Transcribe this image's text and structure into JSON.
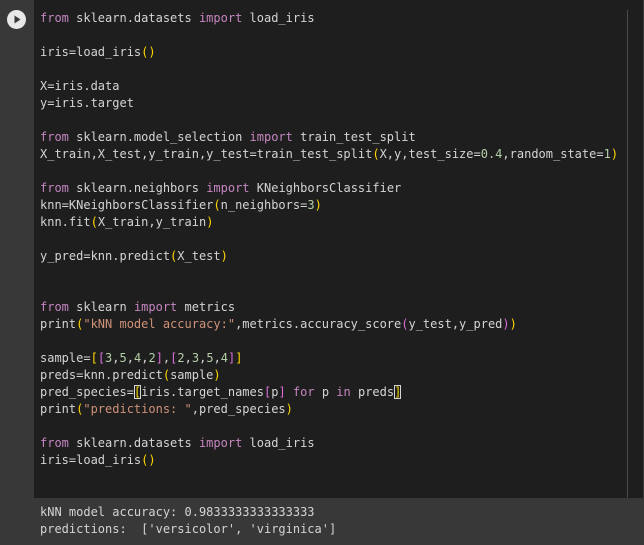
{
  "code_lines": [
    [
      [
        "kw",
        "from"
      ],
      [
        "t",
        " sklearn.datasets "
      ],
      [
        "kw",
        "import"
      ],
      [
        "t",
        " load_iris"
      ]
    ],
    [],
    [
      [
        "t",
        "iris=load_iris"
      ],
      [
        "p1",
        "()"
      ]
    ],
    [],
    [
      [
        "t",
        "X=iris.data"
      ]
    ],
    [
      [
        "t",
        "y=iris.target"
      ]
    ],
    [],
    [
      [
        "kw",
        "from"
      ],
      [
        "t",
        " sklearn.model_selection "
      ],
      [
        "kw",
        "import"
      ],
      [
        "t",
        " train_test_split"
      ]
    ],
    [
      [
        "t",
        "X_train,X_test,y_train,y_test=train_test_split"
      ],
      [
        "p1",
        "("
      ],
      [
        "t",
        "X,y,test_size="
      ],
      [
        "num",
        "0.4"
      ],
      [
        "t",
        ",random_state="
      ],
      [
        "num",
        "1"
      ],
      [
        "p1",
        ")"
      ]
    ],
    [],
    [
      [
        "kw",
        "from"
      ],
      [
        "t",
        " sklearn.neighbors "
      ],
      [
        "kw",
        "import"
      ],
      [
        "t",
        " KNeighborsClassifier"
      ]
    ],
    [
      [
        "t",
        "knn=KNeighborsClassifier"
      ],
      [
        "p1",
        "("
      ],
      [
        "t",
        "n_neighbors="
      ],
      [
        "num",
        "3"
      ],
      [
        "p1",
        ")"
      ]
    ],
    [
      [
        "t",
        "knn.fit"
      ],
      [
        "p1",
        "("
      ],
      [
        "t",
        "X_train,y_train"
      ],
      [
        "p1",
        ")"
      ]
    ],
    [],
    [
      [
        "t",
        "y_pred=knn.predict"
      ],
      [
        "p1",
        "("
      ],
      [
        "t",
        "X_test"
      ],
      [
        "p1",
        ")"
      ]
    ],
    [],
    [],
    [
      [
        "kw",
        "from"
      ],
      [
        "t",
        " sklearn "
      ],
      [
        "kw",
        "import"
      ],
      [
        "t",
        " metrics"
      ]
    ],
    [
      [
        "t",
        "print"
      ],
      [
        "p1",
        "("
      ],
      [
        "str",
        "\"kNN model accuracy:\""
      ],
      [
        "t",
        ",metrics.accuracy_score"
      ],
      [
        "p2",
        "("
      ],
      [
        "t",
        "y_test,y_pred"
      ],
      [
        "p2",
        ")"
      ],
      [
        "p1",
        ")"
      ]
    ],
    [],
    [
      [
        "t",
        "sample="
      ],
      [
        "p1",
        "["
      ],
      [
        "p2",
        "["
      ],
      [
        "num",
        "3"
      ],
      [
        "t",
        ","
      ],
      [
        "num",
        "5"
      ],
      [
        "t",
        ","
      ],
      [
        "num",
        "4"
      ],
      [
        "t",
        ","
      ],
      [
        "num",
        "2"
      ],
      [
        "p2",
        "]"
      ],
      [
        "t",
        ","
      ],
      [
        "p2",
        "["
      ],
      [
        "num",
        "2"
      ],
      [
        "t",
        ","
      ],
      [
        "num",
        "3"
      ],
      [
        "t",
        ","
      ],
      [
        "num",
        "5"
      ],
      [
        "t",
        ","
      ],
      [
        "num",
        "4"
      ],
      [
        "p2",
        "]"
      ],
      [
        "p1",
        "]"
      ]
    ],
    [
      [
        "t",
        "preds=knn.predict"
      ],
      [
        "p1",
        "("
      ],
      [
        "t",
        "sample"
      ],
      [
        "p1",
        ")"
      ]
    ],
    [
      [
        "t",
        "pred_species="
      ],
      [
        "p1c",
        "["
      ],
      [
        "t",
        "iris.target_names"
      ],
      [
        "p2",
        "["
      ],
      [
        "t",
        "p"
      ],
      [
        "p2",
        "]"
      ],
      [
        "t",
        " "
      ],
      [
        "kw",
        "for"
      ],
      [
        "t",
        " p "
      ],
      [
        "kw",
        "in"
      ],
      [
        "t",
        " preds"
      ],
      [
        "p1c",
        "]"
      ]
    ],
    [
      [
        "t",
        "print"
      ],
      [
        "p1",
        "("
      ],
      [
        "str",
        "\"predictions: \""
      ],
      [
        "t",
        ",pred_species"
      ],
      [
        "p1",
        ")"
      ]
    ],
    [],
    [
      [
        "kw",
        "from"
      ],
      [
        "t",
        " sklearn.datasets "
      ],
      [
        "kw",
        "import"
      ],
      [
        "t",
        " load_iris"
      ]
    ],
    [
      [
        "t",
        "iris=load_iris"
      ],
      [
        "p1",
        "()"
      ]
    ]
  ],
  "output": {
    "line1": "kNN model accuracy: 0.9833333333333333",
    "line2": "predictions:  ['versicolor', 'virginica']"
  },
  "icons": {
    "run": "play-circle-icon"
  },
  "colors": {
    "keyword": "#c586c0",
    "string": "#ce9178",
    "number": "#b5cea8",
    "bracket_level1": "#ffd700",
    "bracket_level2": "#da70d6",
    "text": "#d4d4d4",
    "editor_bg": "#1e1e1e",
    "panel_bg": "#383838"
  }
}
